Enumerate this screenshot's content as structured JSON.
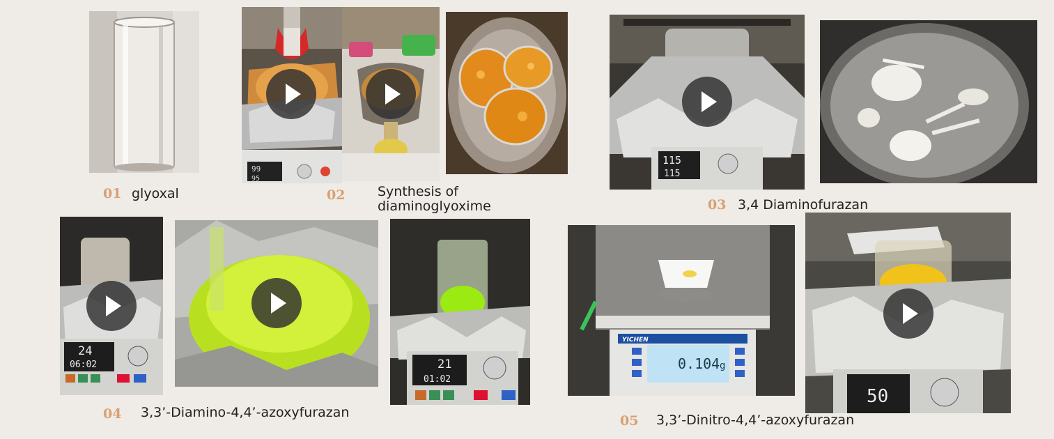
{
  "steps": [
    {
      "num": "01",
      "label": "glyoxal"
    },
    {
      "num": "02",
      "label_line1": "Synthesis of",
      "label_line2": "diaminoglyoxime"
    },
    {
      "num": "03",
      "label": "3,4 Diaminofurazan"
    },
    {
      "num": "04",
      "label": "3,3’-Diamino-4,4’-azoxyfurazan"
    },
    {
      "num": "05",
      "label": "3,3’-Dinitro-4,4’-azoxyfurazan"
    }
  ],
  "displays": {
    "stirrer_02": {
      "temp": "99",
      "set": "95"
    },
    "stirrer_03": {
      "temp": "115",
      "set": "115"
    },
    "stirrer_04a": {
      "temp": "24",
      "time": "06:02"
    },
    "stirrer_04b": {
      "temp": "21",
      "time": "01:02"
    },
    "balance_05": {
      "brand": "YICHEN",
      "reading": "0.104",
      "unit": "g"
    },
    "stirrer_05": {
      "temp": "50"
    }
  },
  "colors": {
    "background": "#efebe6",
    "step_number": "#d9a074",
    "label_text": "#222222",
    "play_overlay": "#303030"
  },
  "icons": {
    "video": "play-icon"
  }
}
